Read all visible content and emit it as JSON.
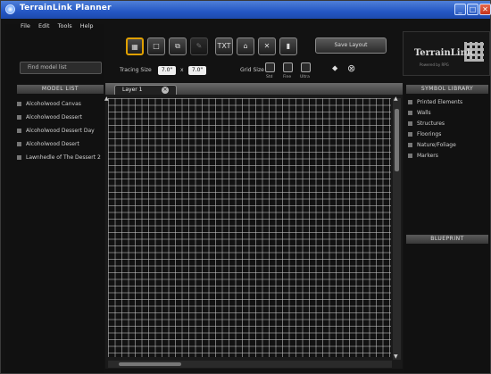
{
  "window": {
    "title": "TerrainLink Planner",
    "min": "_",
    "max": "□",
    "close": "✕"
  },
  "menu": [
    "File",
    "Edit",
    "Tools",
    "Help"
  ],
  "search": {
    "placeholder": "Find model list"
  },
  "model_list": {
    "header": "MODEL LIST",
    "items": [
      "Alcoholwood Canvas",
      "Alcoholwood Dessert",
      "Alcoholwood Dessert Day",
      "Alcoholwood Desert",
      "Lawnhedle of The Dessert 2"
    ]
  },
  "toolbar": {
    "tools": [
      "▦",
      "□",
      "⧉",
      "✎",
      "TXT",
      "⌂",
      "✕",
      "▮"
    ],
    "wide_button": "Save Layout",
    "tracing_label": "Tracing Size",
    "tracing_w": "7.0\"",
    "tracing_sep": "x",
    "tracing_h": "7.0\"",
    "grid_label": "Grid Size",
    "grid_opts": [
      "Std",
      "Fine",
      "Ultra"
    ],
    "extra_icons": [
      "⬥",
      "⊗"
    ]
  },
  "logo": {
    "brand": "TerrainLink",
    "sub": "Powered by RPG"
  },
  "canvas": {
    "tab_label": "Layer 1",
    "tab_close": "×"
  },
  "symbol_library": {
    "header": "SYMBOL LIBRARY",
    "items": [
      "Printed Elements",
      "Walls",
      "Structures",
      "Floorings",
      "Nature/Foliage",
      "Markers"
    ]
  },
  "blueprint": {
    "header": "BLUEPRINT"
  }
}
